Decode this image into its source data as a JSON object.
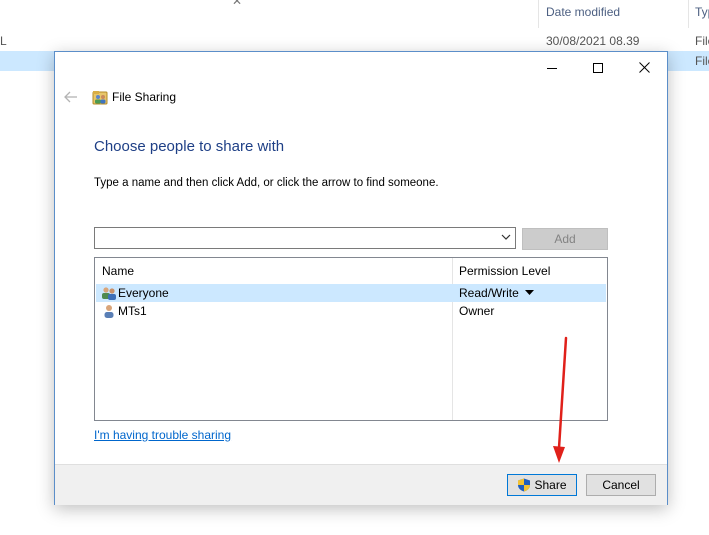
{
  "background": {
    "columns": {
      "date_modified": "Date modified",
      "type_partial": "Typ"
    },
    "rows": [
      {
        "name_partial": "L",
        "date": "30/08/2021 08.39",
        "type_partial": "File"
      },
      {
        "name_partial": "",
        "date": "",
        "type_partial": "File"
      }
    ]
  },
  "dialog": {
    "nav_title": "File Sharing",
    "heading": "Choose people to share with",
    "instruction": "Type a name and then click Add, or click the arrow to find someone.",
    "name_input": {
      "value": ""
    },
    "add_label": "Add",
    "list": {
      "headers": {
        "name": "Name",
        "permission": "Permission Level"
      },
      "rows": [
        {
          "name": "Everyone",
          "permission": "Read/Write"
        },
        {
          "name": "MTs1",
          "permission": "Owner"
        }
      ]
    },
    "trouble_link": "I'm having trouble sharing",
    "share_label": "Share",
    "cancel_label": "Cancel"
  },
  "colors": {
    "accent": "#0078d7",
    "heading": "#1e3f86",
    "link": "#0066cc",
    "selection": "#cce8ff",
    "annotation_arrow": "#e0201a"
  },
  "icons": [
    "close-icon",
    "minimize-icon",
    "maximize-icon",
    "back-arrow-icon",
    "file-sharing-icon",
    "dropdown-chevron-icon",
    "group-users-icon",
    "user-icon",
    "uac-shield-icon"
  ]
}
